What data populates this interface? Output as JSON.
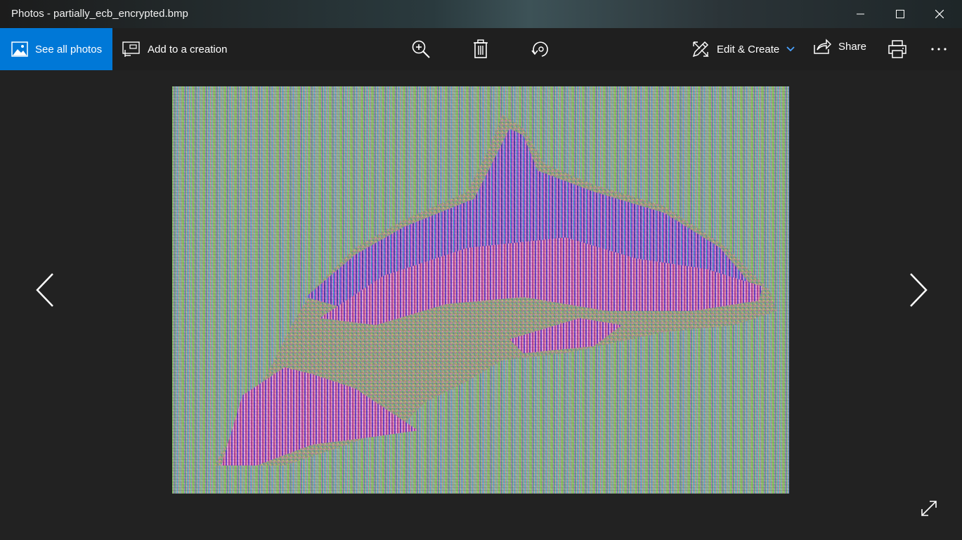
{
  "window": {
    "title": "Photos - partially_ecb_encrypted.bmp"
  },
  "toolbar": {
    "see_all_photos_label": "See all photos",
    "add_to_creation_label": "Add to a creation",
    "edit_create_label": "Edit & Create",
    "share_label": "Share",
    "more_label": "···"
  },
  "icons": {
    "photos_app": "photos-icon",
    "add_to_creation": "add-to-creation-icon",
    "zoom": "zoom-in-icon",
    "delete": "trash-icon",
    "rotate": "rotate-icon",
    "edit_create": "edit-create-icon",
    "share": "share-icon",
    "print": "print-icon",
    "more": "more-dots-icon",
    "prev": "chevron-left-icon",
    "next": "chevron-right-icon",
    "fullscreen": "expand-icon",
    "minimize": "minimize-icon",
    "maximize": "maximize-icon",
    "close": "close-icon"
  },
  "colors": {
    "accent": "#0078d7",
    "toolbar_bg": "#1f1f1f",
    "stage_bg": "#222222"
  }
}
